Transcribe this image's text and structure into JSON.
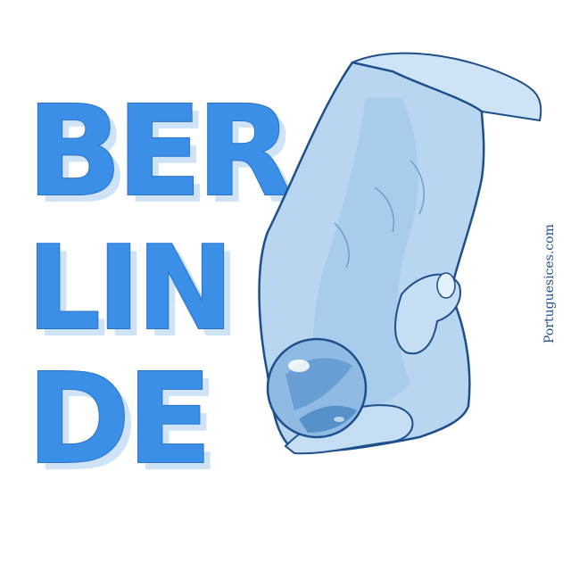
{
  "lettering": {
    "line1": "BER",
    "line2": "LIN",
    "line3": "DE"
  },
  "watermark": "Portuguesices.com",
  "colors": {
    "letter_fill": "#3b8fe6",
    "letter_outline": "#2a72c8",
    "letter_shadow": "#cfe3f7",
    "hand_fill": "#b9d6f0",
    "hand_outline": "#1d4f8c",
    "marble": "#7fb0de",
    "watermark": "#1f4f8f"
  }
}
